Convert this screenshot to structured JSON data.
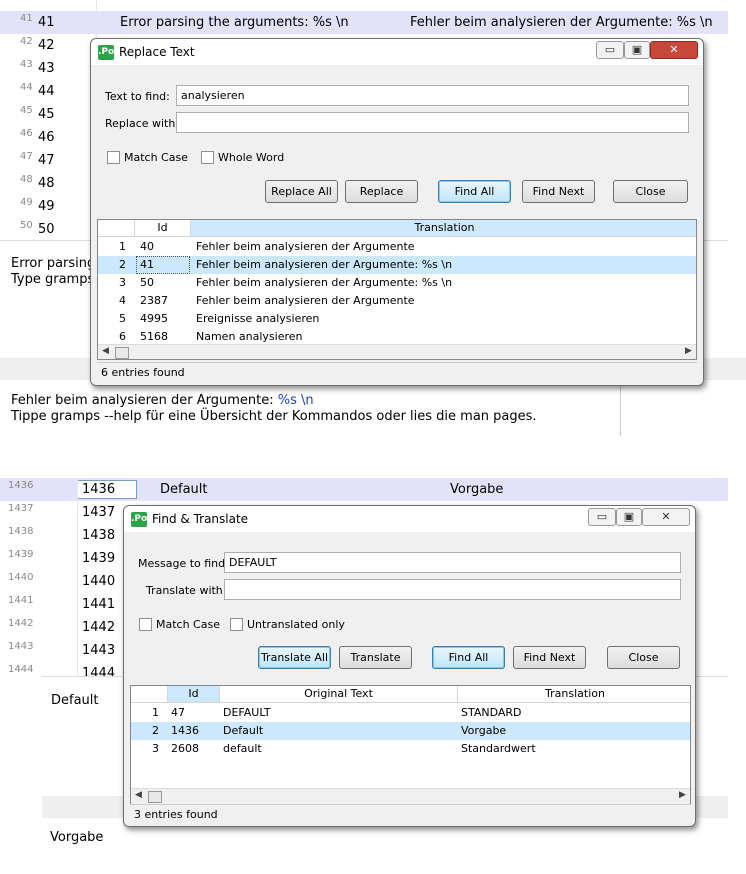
{
  "top_grid": {
    "rows": [
      {
        "ln": "41",
        "num": "41",
        "source": "Error parsing the arguments: %s \\n",
        "translation": "Fehler beim analysieren der Argumente: %s \\n",
        "selected": true
      },
      {
        "ln": "42",
        "num": "42"
      },
      {
        "ln": "43",
        "num": "43"
      },
      {
        "ln": "44",
        "num": "44"
      },
      {
        "ln": "45",
        "num": "45"
      },
      {
        "ln": "46",
        "num": "46"
      },
      {
        "ln": "47",
        "num": "47"
      },
      {
        "ln": "48",
        "num": "48"
      },
      {
        "ln": "49",
        "num": "49"
      },
      {
        "ln": "50",
        "num": "50"
      }
    ],
    "source_partial_1": "Error parsing",
    "source_partial_2": "Type gramps",
    "translation_line1_a": "Fehler beim analysieren der Argumente: ",
    "translation_line1_b": "%s \\n",
    "translation_line2": "Tippe gramps --help für eine Übersicht der Kommandos oder lies die man pages."
  },
  "replace_dialog": {
    "title": "Replace Text",
    "find_label": "Text to find:",
    "find_value": "analysieren",
    "replace_label": "Replace with:",
    "replace_value": "",
    "match_case": "Match Case",
    "whole_word": "Whole Word",
    "buttons": {
      "replace_all": "Replace All",
      "replace": "Replace",
      "find_all": "Find All",
      "find_next": "Find Next",
      "close": "Close"
    },
    "columns": {
      "id": "Id",
      "translation": "Translation"
    },
    "rows": [
      {
        "idx": "1",
        "id": "40",
        "translation": "Fehler beim analysieren der Argumente"
      },
      {
        "idx": "2",
        "id": "41",
        "translation": "Fehler beim analysieren der Argumente: %s \\n"
      },
      {
        "idx": "3",
        "id": "50",
        "translation": "Fehler beim analysieren der Argumente: %s \\n"
      },
      {
        "idx": "4",
        "id": "2387",
        "translation": "Fehler beim analysieren der Argumente"
      },
      {
        "idx": "5",
        "id": "4995",
        "translation": "Ereignisse analysieren"
      },
      {
        "idx": "6",
        "id": "5168",
        "translation": "Namen analysieren"
      }
    ],
    "status": "6 entries found"
  },
  "bottom_grid": {
    "rows": [
      {
        "ln": "1436",
        "num": "1436",
        "source": "Default",
        "translation": "Vorgabe",
        "selected": true
      },
      {
        "ln": "1437",
        "num": "1437"
      },
      {
        "ln": "1438",
        "num": "1438"
      },
      {
        "ln": "1439",
        "num": "1439"
      },
      {
        "ln": "1440",
        "num": "1440"
      },
      {
        "ln": "1441",
        "num": "1441"
      },
      {
        "ln": "1442",
        "num": "1442"
      },
      {
        "ln": "1443",
        "num": "1443"
      },
      {
        "ln": "1444",
        "num": "1444"
      }
    ],
    "source_text": "Default",
    "translation_text": "Vorgabe"
  },
  "find_dialog": {
    "title": "Find & Translate",
    "find_label": "Message to find:",
    "find_value": "DEFAULT",
    "translate_label": "Translate with:",
    "translate_value": "",
    "match_case": "Match Case",
    "untranslated": "Untranslated only",
    "buttons": {
      "translate_all": "Translate All",
      "translate": "Translate",
      "find_all": "Find All",
      "find_next": "Find Next",
      "close": "Close"
    },
    "columns": {
      "id": "Id",
      "original": "Original Text",
      "translation": "Translation"
    },
    "rows": [
      {
        "idx": "1",
        "id": "47",
        "original": "DEFAULT",
        "translation": "STANDARD"
      },
      {
        "idx": "2",
        "id": "1436",
        "original": "Default",
        "translation": "Vorgabe"
      },
      {
        "idx": "3",
        "id": "2608",
        "original": "default",
        "translation": "Standardwert"
      }
    ],
    "status": "3 entries found"
  },
  "colors": {
    "row_selected": "#e2e2fb",
    "list_selected": "#cce8ff",
    "accent_icon": "#2ea44a",
    "close_red": "#c9483c"
  },
  "icons": {
    "app": "po-app-icon",
    "minimize": "minimize-icon",
    "maximize": "maximize-icon",
    "close": "close-icon"
  }
}
